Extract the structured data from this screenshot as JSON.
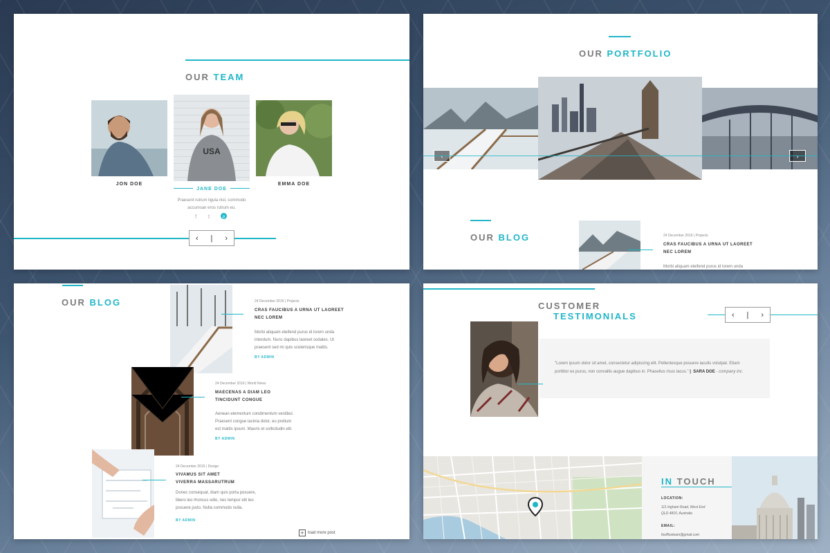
{
  "team": {
    "title_a": "OUR",
    "title_b": "TEAM",
    "members": [
      {
        "name": "JON DOE"
      },
      {
        "name": "JANE DOE"
      },
      {
        "name": "EMMA DOE"
      }
    ],
    "bio_line1": "Praesent rutrum ligula nisl, commodo",
    "bio_line2": "accumsan eros rutrum eu.",
    "prev": "‹",
    "sep": "|",
    "next": "›",
    "social_icons": [
      "facebook-icon",
      "twitter-icon",
      "pinterest-icon"
    ]
  },
  "portfolio": {
    "title_a": "OUR",
    "title_b": "PORTFOLIO",
    "prev": "‹",
    "next": "›"
  },
  "blog_preview": {
    "title_a": "OUR",
    "title_b": "BLOG",
    "meta": "24 December 2016 | Projects",
    "post_title_1": "CRAS FAUCIBUS A URNA UT LAOREET",
    "post_title_2": "NEC LOREM",
    "excerpt": "Morbi aliquam eleifend purus id lorem unda"
  },
  "blog": {
    "title_a": "OUR",
    "title_b": "BLOG",
    "posts": [
      {
        "meta": "24 December 2016 | Projects",
        "title1": "CRAS FAUCIBUS A URNA UT LAOREET",
        "title2": "NEC LOREM",
        "text1": "Morbi aliquam eleifend purus id lorem unda",
        "text2": "interdum. Nunc dapibus laoreet sodales. Ut",
        "text3": "praesent sed mi quis scelerisque mattis.",
        "by": "BY ADMIN"
      },
      {
        "meta": "24 December 2016 | World News",
        "title1": "MAECENAS A DIAM LEO",
        "title2": "TINCIDUNT CONGUE",
        "text1": "Aenean elementum condimentum vestibul.",
        "text2": "Praesent congue lacinia dolor, eu pretium",
        "text3": "est mattis ipsum. Mauris et sollicitudin elit.",
        "by": "BY ADMIN"
      },
      {
        "meta": "24 December 2016 | Design",
        "title1": "VIVAMUS SIT AMET",
        "title2": "VIVERRA MASSARUTRUM",
        "text1": "Donec consequat, diam quis porta posuere,",
        "text2": "libero leo rhoncus odio, nec tempor elit leo",
        "text3": "posuere justo. Nulla commodo nulla.",
        "by": "BY ADMIN"
      }
    ],
    "load_more": "load more post"
  },
  "testimonials": {
    "title_line1": "CUSTOMER",
    "title_line2": "TESTIMONIALS",
    "prev": "‹",
    "sep": "|",
    "next": "›",
    "quote_line1": "\"Lorem ipsum dolor sit amet, consectetur adipiscing elit. Pellentesque posuere iaculis volutpat. Etiam",
    "quote_line2": "porttitor ex purus, non convallis augue dapibus in. Phasellus risus lacus.\"",
    "author": "SARA DOE",
    "company": "- company inc."
  },
  "contact": {
    "title_a": "IN",
    "title_b": "TOUCH",
    "location_label": "LOCATION:",
    "location_line1": "111 Ingham Road, West End",
    "location_line2": "QLD 4810, Australia",
    "email_label": "EMAIL:",
    "email_value": "foofficeteam@gmail.com"
  },
  "colors": {
    "accent": "#1fb6c8",
    "title_gray": "#7a7a7a"
  }
}
